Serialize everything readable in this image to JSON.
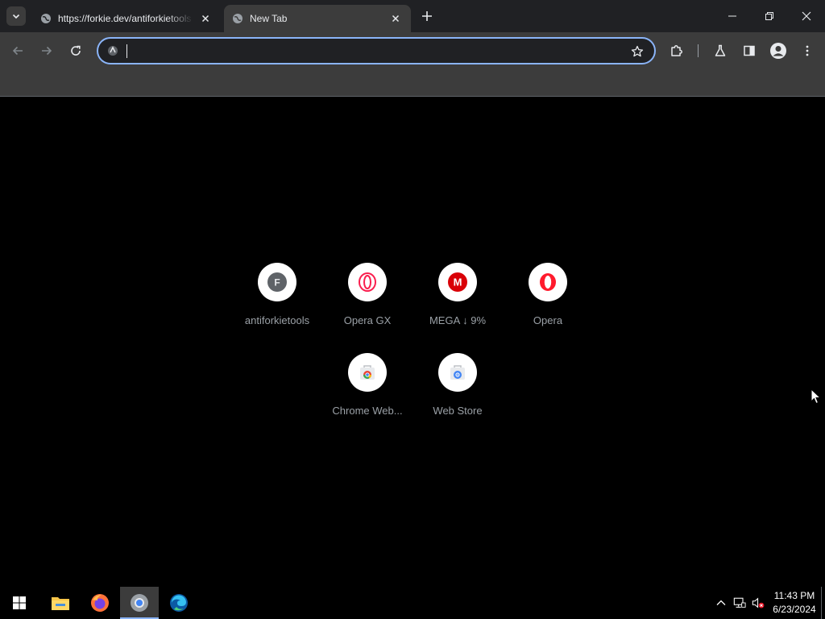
{
  "browser": {
    "tabs": [
      {
        "title": "https://forkie.dev/antiforkietools",
        "active": false
      },
      {
        "title": "New Tab",
        "active": true
      }
    ],
    "omnibox": {
      "value": "",
      "placeholder": ""
    }
  },
  "new_tab_page": {
    "shortcuts": [
      {
        "label": "antiforkietools",
        "icon": "letter-F-icon",
        "letter": "F"
      },
      {
        "label": "Opera GX",
        "icon": "opera-gx-icon"
      },
      {
        "label": "MEGA ↓ 9%",
        "icon": "mega-icon",
        "letter": "M"
      },
      {
        "label": "Opera",
        "icon": "opera-icon"
      },
      {
        "label": "Chrome Web...",
        "icon": "chrome-web-store-icon"
      },
      {
        "label": "Web Store",
        "icon": "web-store-icon"
      }
    ]
  },
  "taskbar": {
    "apps": [
      "start-icon",
      "file-explorer-icon",
      "firefox-icon",
      "chrome-icon",
      "edge-icon"
    ],
    "clock": {
      "time": "11:43 PM",
      "date": "6/23/2024"
    }
  },
  "colors": {
    "accent": "#8ab4f8",
    "tabstrip": "#202124",
    "toolbar": "#3c3c3c",
    "mega_red": "#d90007",
    "opera_red": "#ff1b2d"
  }
}
